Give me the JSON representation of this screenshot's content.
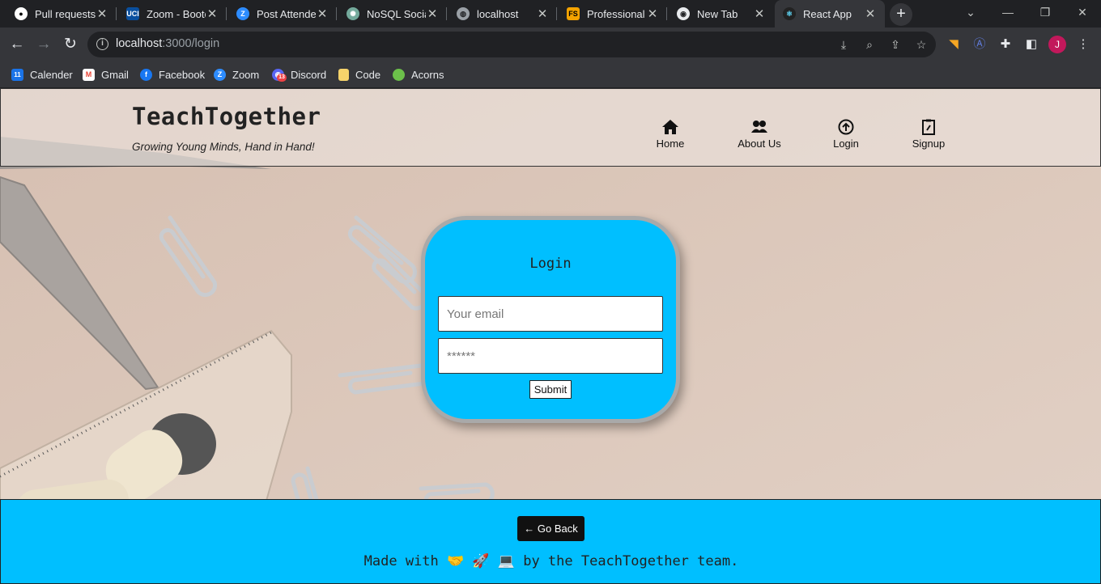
{
  "browser": {
    "tabs": [
      {
        "title": "Pull requests",
        "icon": "github-icon"
      },
      {
        "title": "Zoom - Bootc",
        "icon": "uci-icon"
      },
      {
        "title": "Post Attende",
        "icon": "zoom-icon"
      },
      {
        "title": "NoSQL Social",
        "icon": "chatgpt-icon"
      },
      {
        "title": "localhost",
        "icon": "globe-icon"
      },
      {
        "title": "Professional",
        "icon": "fs-icon"
      },
      {
        "title": "New Tab",
        "icon": "chrome-icon"
      },
      {
        "title": "React App",
        "icon": "react-icon"
      }
    ],
    "active_tab_index": 7,
    "url_host": "localhost",
    "url_path": ":3000/login",
    "profile_initial": "J",
    "bookmarks": [
      {
        "label": "Calender",
        "icon": "calendar-icon"
      },
      {
        "label": "Gmail",
        "icon": "gmail-icon"
      },
      {
        "label": "Facebook",
        "icon": "facebook-icon"
      },
      {
        "label": "Zoom",
        "icon": "zoom-icon"
      },
      {
        "label": "Discord",
        "icon": "discord-icon"
      },
      {
        "label": "Code",
        "icon": "folder-icon"
      },
      {
        "label": "Acorns",
        "icon": "acorns-icon"
      }
    ],
    "calendar_badge": "11",
    "discord_badge": "13"
  },
  "header": {
    "brand": "TeachTogether",
    "tagline": "Growing Young Minds, Hand in Hand!",
    "nav": [
      {
        "label": "Home",
        "icon": "home-icon"
      },
      {
        "label": "About Us",
        "icon": "people-icon"
      },
      {
        "label": "Login",
        "icon": "upload-circle-icon"
      },
      {
        "label": "Signup",
        "icon": "clipboard-icon"
      }
    ]
  },
  "login": {
    "title": "Login",
    "email_placeholder": "Your email",
    "password_placeholder": "******",
    "submit_label": "Submit"
  },
  "footer": {
    "back_label": "← Go Back",
    "credit": "Made with 🤝 🚀 💻 by the TeachTogether team."
  },
  "colors": {
    "accent": "#00bfff",
    "page_bg": "#dcc8bb",
    "chrome_dark": "#202124",
    "chrome_toolbar": "#35363a"
  }
}
